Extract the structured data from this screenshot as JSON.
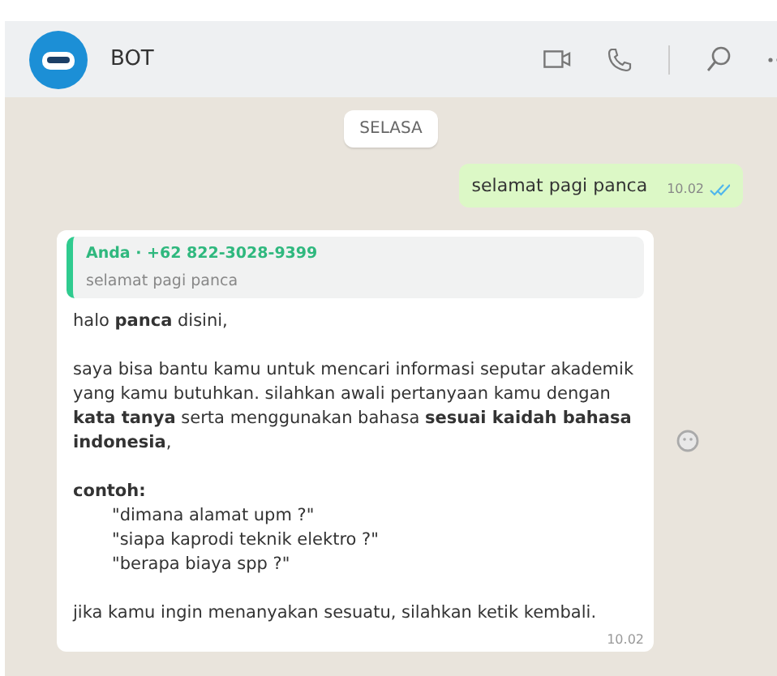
{
  "header": {
    "title": "BOT"
  },
  "day_chip": "SELASA",
  "outgoing": {
    "text": "selamat pagi panca",
    "time": "10.02",
    "read": true
  },
  "incoming": {
    "quote": {
      "author": "Anda · +62 822-3028-9399",
      "text": "selamat pagi panca"
    },
    "blocks": [
      {
        "kind": "text",
        "text": "halo **panca** disini,"
      },
      {
        "kind": "text",
        "text": "saya bisa bantu kamu untuk mencari informasi seputar akademik yang kamu butuhkan. silahkan awali pertanyaan kamu dengan **kata tanya** serta menggunakan bahasa **sesuai kaidah bahasa indonesia**,"
      },
      {
        "kind": "examples",
        "heading": "contoh:",
        "items": [
          "\"dimana alamat upm ?\"",
          "\"siapa kaprodi teknik elektro ?\"",
          "\"berapa biaya spp ?\""
        ]
      },
      {
        "kind": "text",
        "text": "jika kamu ingin menanyakan sesuatu, silahkan ketik kembali."
      }
    ],
    "time": "10.02"
  }
}
